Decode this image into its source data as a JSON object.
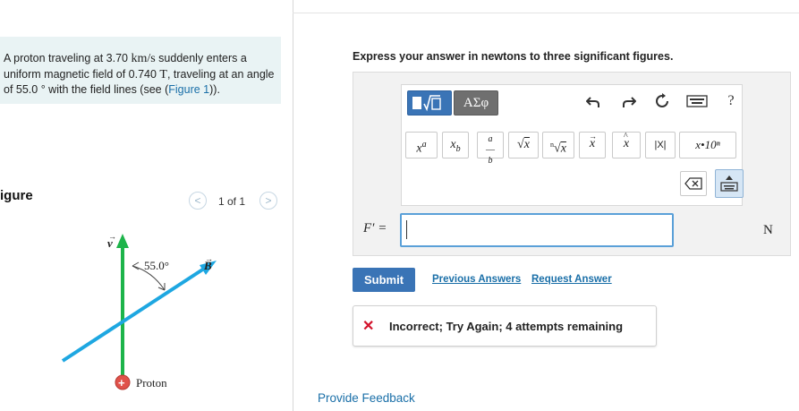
{
  "problem": {
    "text_1": "A proton traveling at 3.70 ",
    "speed_unit": "km/s",
    "text_2": " suddenly enters a uniform magnetic field of 0.740 ",
    "field_unit": "T",
    "text_3": ", traveling at an angle of 55.0 ° with the field lines (see (",
    "figure_link": "Figure 1",
    "text_4": "))."
  },
  "figure": {
    "label": "igure",
    "pager_prev": "<",
    "pager_text": "1 of 1",
    "pager_next": ">",
    "v_label": "v",
    "angle_label": "55.0°",
    "b_label": "B",
    "proton_sign": "+",
    "proton_label": "Proton",
    "colors": {
      "field": "#1db44a",
      "velocity": "#1ea7e1",
      "proton": "#e0524a"
    }
  },
  "question": {
    "instructions": "Express your answer in newtons to three significant figures.",
    "answer_label": "F′ =",
    "answer_value": "",
    "unit": "N"
  },
  "toolbar": {
    "greek": "ΑΣφ",
    "help": "?",
    "sci_notation": "x•10ⁿ",
    "abs": "|X|",
    "icons": [
      "templates-icon",
      "greek-icon",
      "undo-icon",
      "redo-icon",
      "reset-icon",
      "keyboard-icon",
      "help-icon",
      "superscript-icon",
      "subscript-icon",
      "fraction-icon",
      "sqrt-icon",
      "nth-root-icon",
      "vector-icon",
      "unit-vector-icon",
      "abs-icon",
      "sci-notation-icon",
      "backspace-icon",
      "keyboard-toggle-icon"
    ]
  },
  "actions": {
    "submit": "Submit",
    "previous_answers": "Previous Answers",
    "request_answer": "Request Answer"
  },
  "feedback": {
    "icon": "✕",
    "message": "Incorrect; Try Again; 4 attempts remaining",
    "provide_feedback": "Provide Feedback"
  }
}
